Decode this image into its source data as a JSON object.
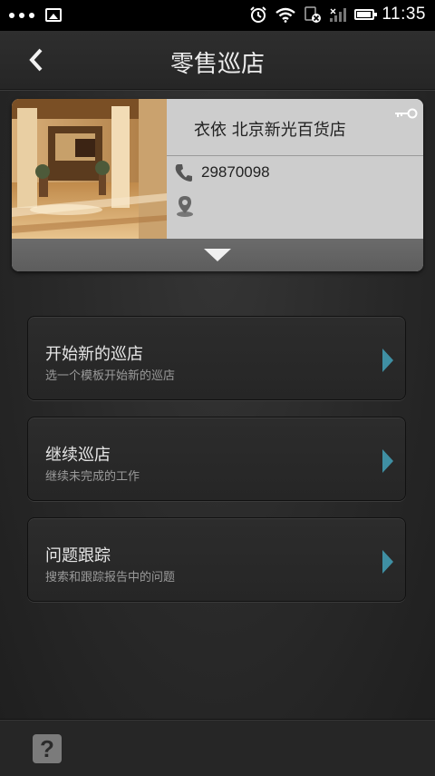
{
  "status_bar": {
    "time": "11:35",
    "icons": [
      "more-dots-icon",
      "image-icon",
      "alarm-icon",
      "wifi-icon",
      "sim-off-icon",
      "signal-icon",
      "battery-icon"
    ]
  },
  "header": {
    "title": "零售巡店",
    "back_icon": "back-arrow-icon"
  },
  "store": {
    "name": "衣依 北京新光百货店",
    "phone": "29870098",
    "address": "",
    "key_icon": "key-icon",
    "expand_icon": "chevron-down-icon"
  },
  "menu": [
    {
      "title": "开始新的巡店",
      "subtitle": "选一个模板开始新的巡店"
    },
    {
      "title": "继续巡店",
      "subtitle": "继续未完成的工作"
    },
    {
      "title": "问题跟踪",
      "subtitle": "搜索和跟踪报告中的问题"
    }
  ],
  "footer": {
    "help_label": "?"
  },
  "colors": {
    "background": "#2a2a2a",
    "card": "#cdcdcd",
    "arrow_accent": "#3f8fa3",
    "subtitle": "#9a9a9a"
  }
}
